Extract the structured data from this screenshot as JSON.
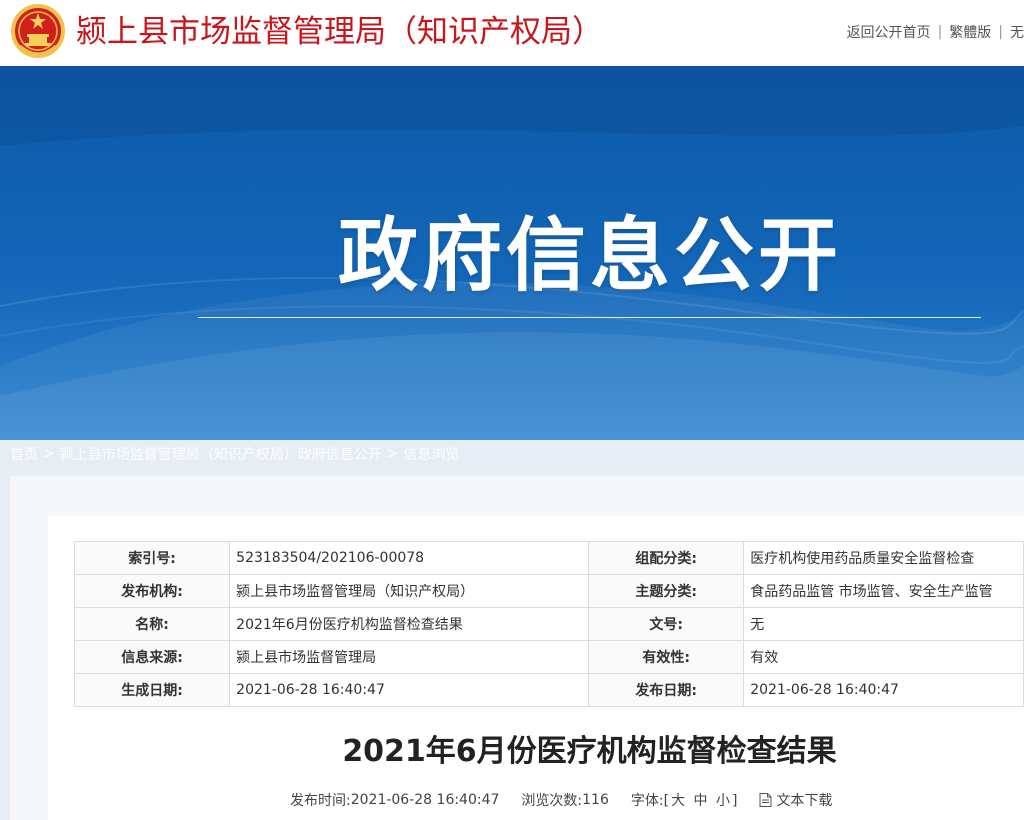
{
  "header": {
    "site_title": "颍上县市场监督管理局（知识产权局）",
    "links": {
      "home": "返回公开首页",
      "separator": "|",
      "traditional": "繁體版",
      "cut": "无"
    }
  },
  "banner": {
    "title": "政府信息公开"
  },
  "breadcrumb": {
    "items": [
      "首页",
      "颍上县市场监督管理局（知识产权局）政府信息公开",
      "信息浏览"
    ],
    "separator": ">"
  },
  "meta": {
    "rows": [
      {
        "label1": "索引号:",
        "value1": "523183504/202106-00078",
        "label2": "组配分类:",
        "value2": "医疗机构使用药品质量安全监督检查"
      },
      {
        "label1": "发布机构:",
        "value1": "颍上县市场监督管理局（知识产权局）",
        "label2": "主题分类:",
        "value2": "食品药品监管  市场监管、安全生产监管"
      },
      {
        "label1": "名称:",
        "value1": "2021年6月份医疗机构监督检查结果",
        "label2": "文号:",
        "value2": "无"
      },
      {
        "label1": "信息来源:",
        "value1": "颍上县市场监督管理局",
        "label2": "有效性:",
        "value2": "有效"
      },
      {
        "label1": "生成日期:",
        "value1": "2021-06-28 16:40:47",
        "label2": "发布日期:",
        "value2": "2021-06-28 16:40:47"
      }
    ]
  },
  "article": {
    "title": "2021年6月份医疗机构监督检查结果",
    "publish_label": "发布时间:",
    "publish_time": "2021-06-28 16:40:47",
    "views_label": "浏览次数:",
    "views": "116",
    "font_label": "字体:",
    "font_open": "[",
    "font_large": "大",
    "font_medium": "中",
    "font_small": "小",
    "font_close": "]",
    "download_label": "文本下载"
  },
  "colors": {
    "title_red": "#c8161d",
    "banner_blue": "#1366b8"
  },
  "icons": {
    "emblem": "national-emblem-icon",
    "download": "document-icon"
  }
}
